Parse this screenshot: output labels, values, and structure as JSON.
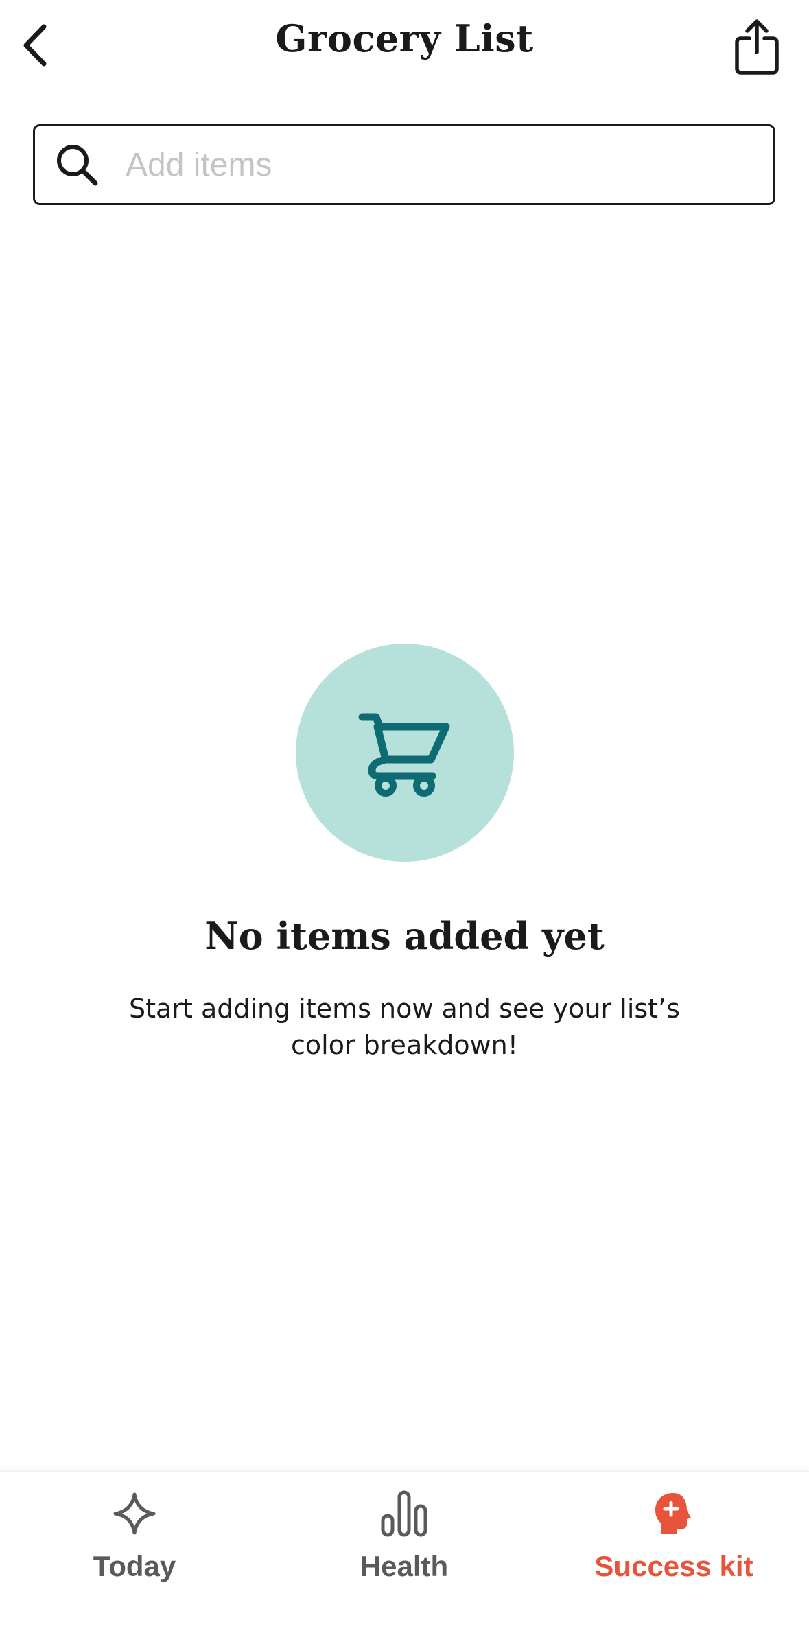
{
  "header": {
    "title": "Grocery List",
    "back_icon": "chevron-left-icon",
    "share_icon": "share-icon"
  },
  "search": {
    "placeholder": "Add items",
    "value": "",
    "icon": "search-icon"
  },
  "empty_state": {
    "icon": "shopping-cart-icon",
    "title": "No items added yet",
    "description": "Start adding items now and see your list’s color breakdown!"
  },
  "tabs": [
    {
      "label": "Today",
      "icon": "sparkle-icon",
      "active": false
    },
    {
      "label": "Health",
      "icon": "bar-chart-icon",
      "active": false
    },
    {
      "label": "Success kit",
      "icon": "head-plus-icon",
      "active": true
    }
  ],
  "colors": {
    "accent": "#e8533c",
    "tab_inactive": "#5a5a5a",
    "cart_circle": "#b5e1da",
    "cart_icon": "#0e6b73",
    "text": "#1a1a1a",
    "placeholder": "#c4c4c4"
  }
}
